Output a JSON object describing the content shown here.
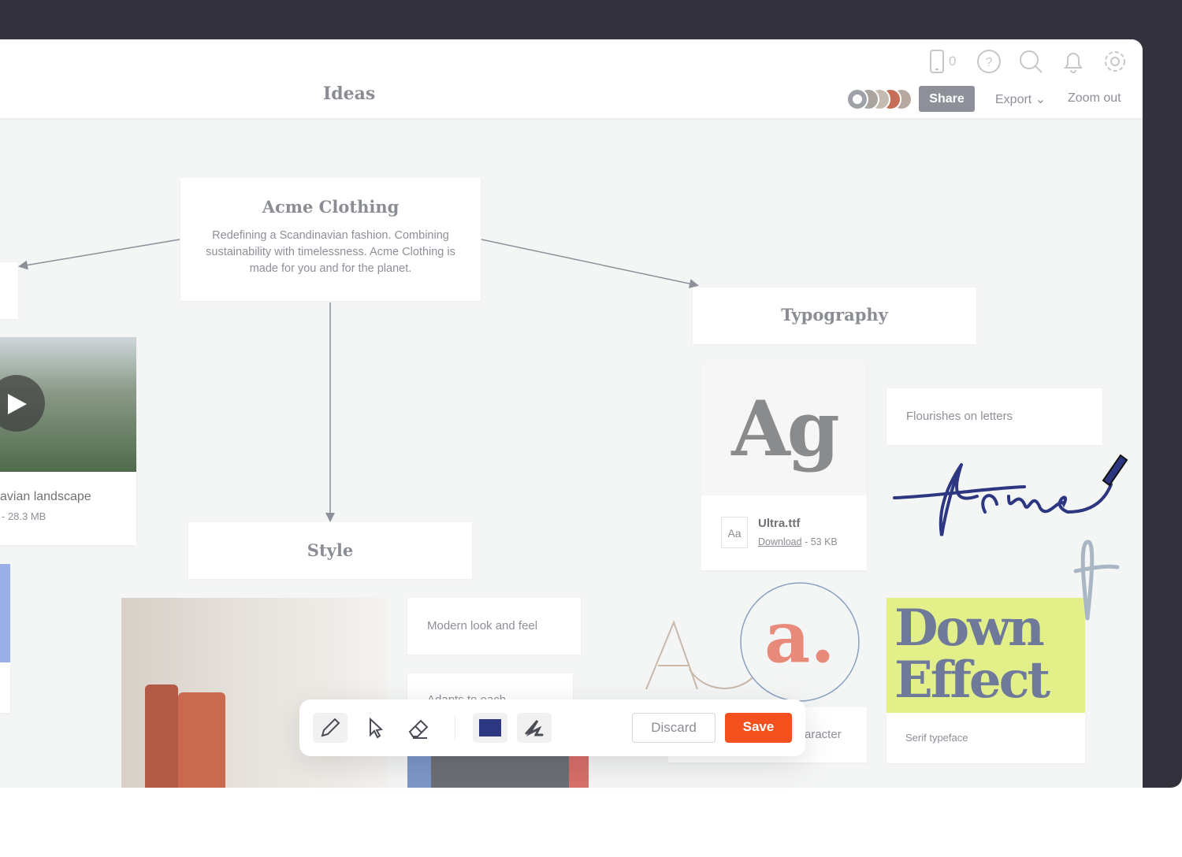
{
  "header": {
    "title": "Ideas",
    "device_count": "0",
    "share_label": "Share",
    "export_label": "Export",
    "zoom_out_label": "Zoom out",
    "icons": [
      "phone-icon",
      "help-icon",
      "search-icon",
      "bell-icon",
      "gear-icon"
    ]
  },
  "canvas": {
    "main_card": {
      "title": "Acme Clothing",
      "description": "Redefining a Scandinavian fashion. Combining sustainability with timelessness. Acme Clothing is made for you and for the planet."
    },
    "video_card": {
      "title": "avian landscape",
      "meta": "- 28.3 MB"
    },
    "style_card": {
      "title": "Style"
    },
    "typography_card": {
      "title": "Typography"
    },
    "font_file": {
      "preview": "Ag",
      "badge": "Aa",
      "name": "Ultra.ttf",
      "download": "Download",
      "size": "- 53 KB"
    },
    "notes": [
      "Flourishes on letters",
      "Modern look and feel",
      "Adapts to each ...",
      "aracter"
    ],
    "sample": {
      "text": "Down Effect",
      "caption": "Serif typeface",
      "accent": "#e3f08a"
    },
    "sketch_text": "Acme",
    "letters": [
      "A",
      "a."
    ]
  },
  "toolbar": {
    "tools": [
      "pencil",
      "select",
      "eraser",
      "color",
      "stroke"
    ],
    "color": "#2d3680",
    "discard_label": "Discard",
    "save_label": "Save",
    "save_color": "#f4511e"
  }
}
